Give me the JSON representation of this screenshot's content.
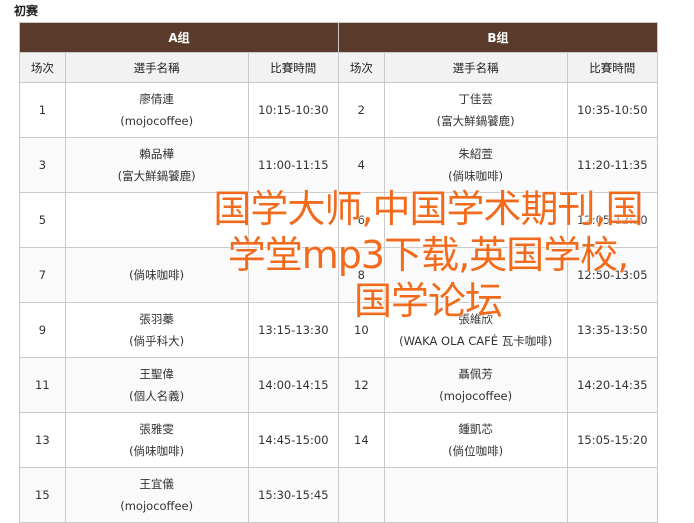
{
  "heading": "初赛",
  "groups": [
    {
      "label": "A组"
    },
    {
      "label": "B组"
    }
  ],
  "columns": {
    "round": "场次",
    "player": "選手名稱",
    "time": "比賽時間"
  },
  "rows": [
    {
      "a": {
        "round": "1",
        "name": "廖倩連",
        "team": "(mojocoffee)",
        "time": "10:15-10:30"
      },
      "b": {
        "round": "2",
        "name": "丁佳芸",
        "team": "(富大鮮鍋饕鹿)",
        "time": "10:35-10:50"
      }
    },
    {
      "a": {
        "round": "3",
        "name": "賴品樺",
        "team": "(富大鮮鍋饕鹿)",
        "time": "11:00-11:15"
      },
      "b": {
        "round": "4",
        "name": "朱紹萱",
        "team": "(倘味咖啡)",
        "time": "11:20-11:35"
      }
    },
    {
      "a": {
        "round": "5",
        "name": "",
        "team": "",
        "time": ""
      },
      "b": {
        "round": "6",
        "name": "",
        "team": "",
        "time": "12:05-12:20"
      }
    },
    {
      "a": {
        "round": "7",
        "name": "",
        "team": "(倘味咖啡)",
        "time": ""
      },
      "b": {
        "round": "8",
        "name": "",
        "team": "",
        "time": "12:50-13:05"
      }
    },
    {
      "a": {
        "round": "9",
        "name": "張羽蓁",
        "team": "(倘乎科大)",
        "time": "13:15-13:30"
      },
      "b": {
        "round": "10",
        "name": "張維欣",
        "team": "(WAKA OLA CAFÉ 瓦卡咖啡)",
        "time": "13:35-13:50"
      }
    },
    {
      "a": {
        "round": "11",
        "name": "王聖偉",
        "team": "(個人名義)",
        "time": "14:00-14:15"
      },
      "b": {
        "round": "12",
        "name": "聶佩芳",
        "team": "(mojocoffee)",
        "time": "14:20-14:35"
      }
    },
    {
      "a": {
        "round": "13",
        "name": "張雅雯",
        "team": "(倘味咖啡)",
        "time": "14:45-15:00"
      },
      "b": {
        "round": "14",
        "name": "鍾凱芯",
        "team": "(倘位咖啡)",
        "time": "15:05-15:20"
      }
    },
    {
      "a": {
        "round": "15",
        "name": "王宜儀",
        "team": "(mojocoffee)",
        "time": "15:30-15:45"
      },
      "b": {
        "round": "",
        "name": "",
        "team": "",
        "time": ""
      }
    }
  ],
  "overlay_text": "国学大师,中国学术期刊,国学堂mp3下载,英国学校,国学论坛",
  "colors": {
    "group_header_bg": "#5a3a2a",
    "column_header_bg": "#f2f2f2",
    "overlay_text": "#f26b1d",
    "border": "#c9c9c9"
  }
}
